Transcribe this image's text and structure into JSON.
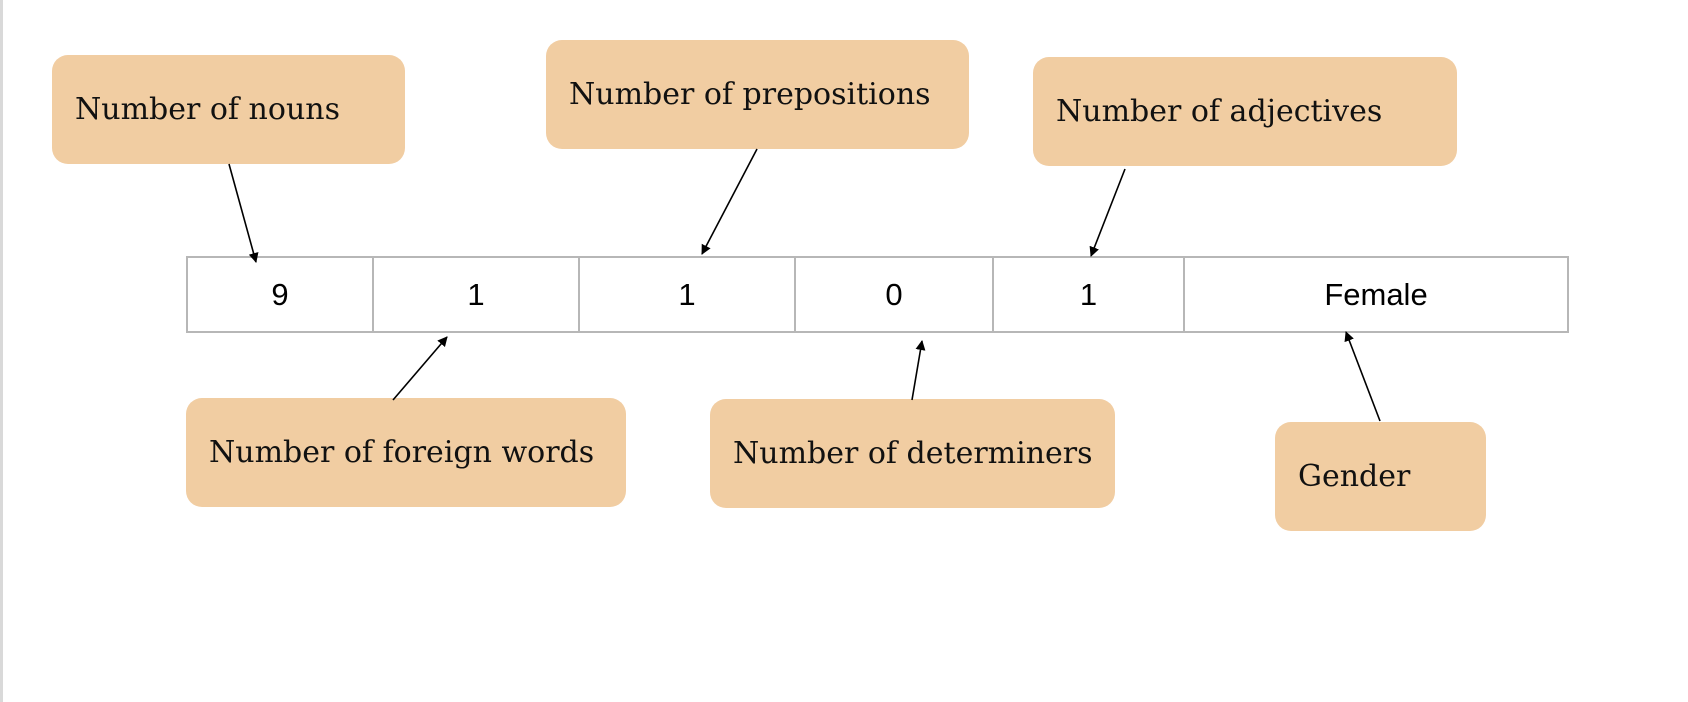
{
  "colors": {
    "label_fill": "#f1cda2",
    "cell_border": "#b7b7b7",
    "arrow": "#000000"
  },
  "labels": {
    "nouns": "Number of nouns",
    "prepositions": "Number of prepositions",
    "adjectives": "Number of adjectives",
    "foreign_words": "Number of foreign words",
    "determiners": "Number of determiners",
    "gender": "Gender"
  },
  "vector": {
    "cells": [
      "9",
      "1",
      "1",
      "0",
      "1",
      "Female"
    ]
  }
}
